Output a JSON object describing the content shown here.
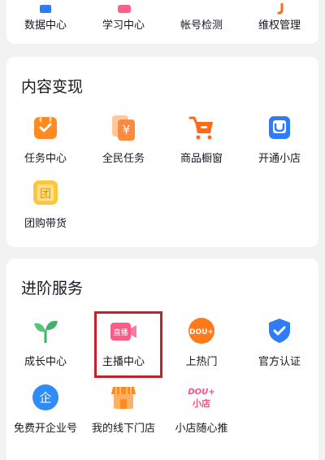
{
  "top_row": {
    "items": [
      {
        "label": "数据中心",
        "icon": "bar-chart-icon"
      },
      {
        "label": "学习中心",
        "icon": "graduation-icon"
      },
      {
        "label": "帐号检测",
        "icon": "check-shield-icon"
      },
      {
        "label": "维权管理",
        "icon": "hook-icon"
      }
    ]
  },
  "content_monetization": {
    "title": "内容变现",
    "items": [
      {
        "label": "任务中心",
        "icon": "task-bag-icon"
      },
      {
        "label": "全民任务",
        "icon": "yuan-cards-icon",
        "glyph": "¥"
      },
      {
        "label": "商品橱窗",
        "icon": "shopping-cart-icon"
      },
      {
        "label": "开通小店",
        "icon": "shop-bag-icon"
      },
      {
        "label": "团购带货",
        "icon": "group-buy-icon",
        "glyph": "团"
      }
    ]
  },
  "advanced_services": {
    "title": "进阶服务",
    "items": [
      {
        "label": "成长中心",
        "icon": "sprout-icon"
      },
      {
        "label": "主播中心",
        "icon": "live-camera-icon",
        "glyph": "直播"
      },
      {
        "label": "上热门",
        "icon": "dou-plus-icon",
        "glyph": "DOU+"
      },
      {
        "label": "官方认证",
        "icon": "verified-shield-icon"
      },
      {
        "label": "免费开企业号",
        "icon": "enterprise-icon",
        "glyph": "企"
      },
      {
        "label": "我的线下门店",
        "icon": "store-awning-icon"
      },
      {
        "label": "小店随心推",
        "icon": "dou-plus-shop-icon",
        "glyph_top": "DOU+",
        "glyph_bottom": "小店"
      }
    ]
  },
  "colors": {
    "orange": "#ff8a1f",
    "cart_orange": "#ff6a1a",
    "blue": "#2f7cf6",
    "green": "#3fb26b",
    "pink": "#ff4d7d",
    "highlight_red": "#c8202a"
  }
}
